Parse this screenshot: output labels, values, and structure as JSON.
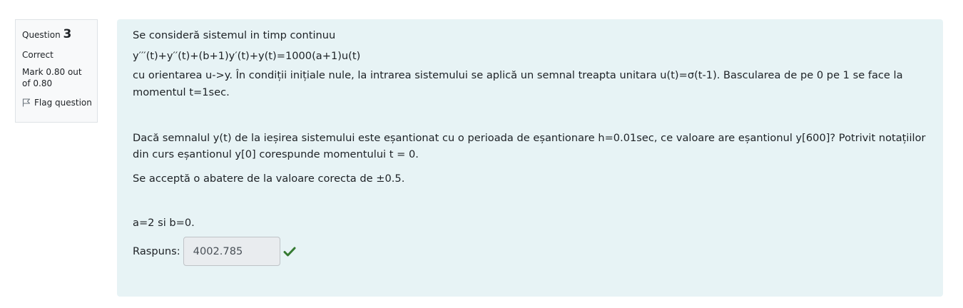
{
  "info": {
    "question_prefix": "Question ",
    "question_number": "3",
    "state": "Correct",
    "grade": "Mark 0.80 out of 0.80",
    "flag_label": "Flag question",
    "flag_icon": "flag-outline-icon"
  },
  "question": {
    "title": "Se consideră sistemul in timp continuu",
    "equation": "y′′′(t)+y′′(t)+(b+1)y′(t)+y(t)=1000(a+1)u(t)",
    "description": "cu orientarea u->y. În condiții inițiale nule, la intrarea sistemului se aplică un semnal treapta unitara u(t)=σ(t-1). Bascularea de pe 0 pe 1 se face la momentul t=1sec.",
    "question_text": "Dacă semnalul y(t) de la ieșirea sistemului este eșantionat cu o perioada de eșantionare h=0.01sec, ce valoare are eșantionul y[600]?  Potrivit notațiilor din curs eșantionul y[0] corespunde momentului t = 0.",
    "tolerance": "Se acceptă o abatere de la valoare corecta de ±0.5.",
    "params": "a=2 si b=0."
  },
  "answer": {
    "label": "Raspuns:",
    "value": "4002.785",
    "status_icon": "check-icon",
    "status_color": "#357a32"
  },
  "colors": {
    "content_bg": "#e7f3f5",
    "info_bg": "#f8f9fa",
    "input_bg": "#e9ecef"
  }
}
